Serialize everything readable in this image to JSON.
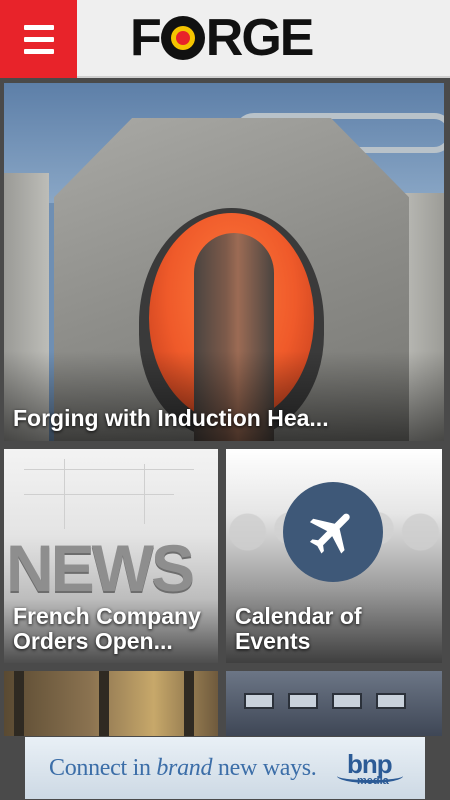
{
  "header": {
    "menu_icon": "hamburger-menu-icon",
    "logo_text": "FORGE",
    "brand_color": "#e8232a"
  },
  "tiles": [
    {
      "title": "Forging with Induction Hea...",
      "image": "induction-heating-photo"
    },
    {
      "title": "French Company Orders Open...",
      "image": "news-graphic",
      "image_text": "NEWS"
    },
    {
      "title": "Calendar of Events",
      "image": "airplane-icon"
    },
    {
      "title": "",
      "image": "forge-shop-photo"
    },
    {
      "title": "",
      "image": "die-machinery-photo"
    }
  ],
  "ad": {
    "text_prefix": "Connect in ",
    "text_emphasis": "brand",
    "text_suffix": " new ways.",
    "logo_main": "bnp",
    "logo_sub": "media"
  }
}
